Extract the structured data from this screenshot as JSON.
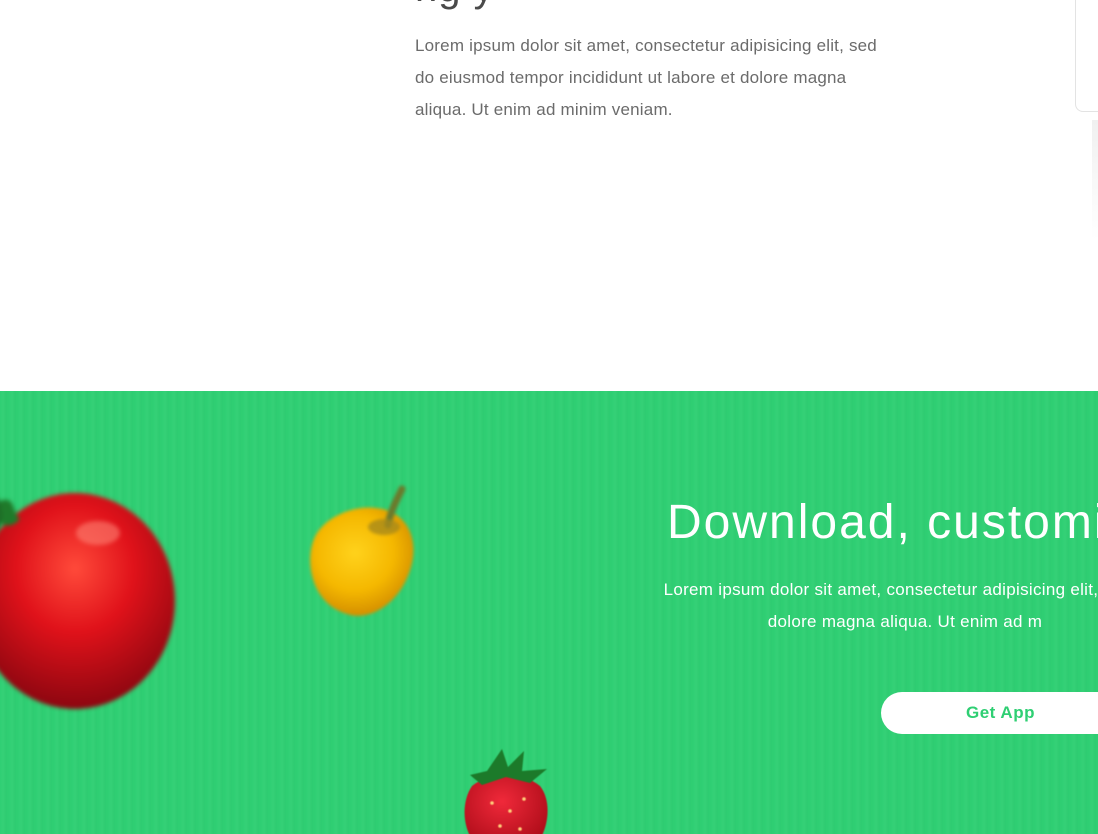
{
  "top_section": {
    "heading_fragment": "ng y",
    "paragraph": "Lorem ipsum dolor sit amet, consectetur adipisicing elit, sed do eiusmod tempor incididunt ut labore et dolore magna aliqua. Ut enim ad minim veniam."
  },
  "download_section": {
    "title": "Download, customiz",
    "text_line1": "Lorem ipsum dolor sit amet, consectetur adipisicing elit, sed d",
    "text_line2": "dolore magna aliqua. Ut enim ad m",
    "button_label": "Get App"
  },
  "decorations": {
    "icons": [
      "tomato-icon",
      "bell-pepper-icon",
      "strawberry-icon"
    ]
  },
  "colors": {
    "accent_green": "#2fcf73",
    "body_text": "#6b6b6b",
    "white": "#ffffff"
  }
}
